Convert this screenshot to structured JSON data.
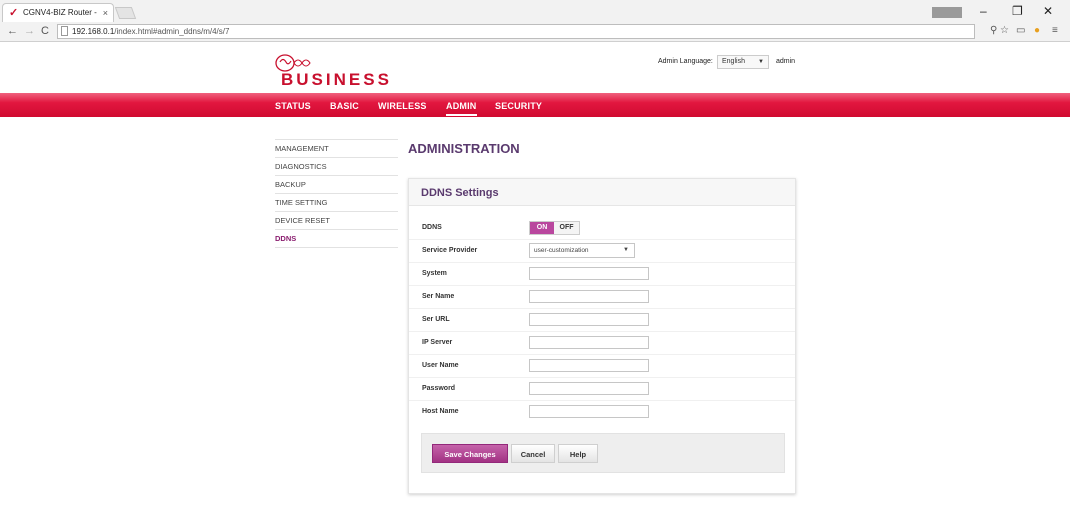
{
  "browser": {
    "tab_title": "CGNV4-BIZ Router -",
    "tab_close": "×",
    "url_host": "192.168.0.1",
    "url_path": "/index.html#admin_ddns/m/4/s/7"
  },
  "header": {
    "brand": "BUSINESS",
    "language_label": "Admin Language:",
    "language_value": "English",
    "user": "admin"
  },
  "nav": {
    "items": [
      {
        "label": "STATUS"
      },
      {
        "label": "BASIC"
      },
      {
        "label": "WIRELESS"
      },
      {
        "label": "ADMIN"
      },
      {
        "label": "SECURITY"
      }
    ],
    "active": "ADMIN"
  },
  "sidebar": {
    "items": [
      {
        "label": "MANAGEMENT"
      },
      {
        "label": "DIAGNOSTICS"
      },
      {
        "label": "BACKUP"
      },
      {
        "label": "TIME SETTING"
      },
      {
        "label": "DEVICE RESET"
      },
      {
        "label": "DDNS"
      }
    ]
  },
  "page": {
    "title": "ADMINISTRATION",
    "card_title": "DDNS Settings"
  },
  "form": {
    "ddns": {
      "label": "DDNS",
      "on": "ON",
      "off": "OFF",
      "state": "ON"
    },
    "service_provider": {
      "label": "Service Provider",
      "value": "user-customization"
    },
    "fields": [
      {
        "label": "System",
        "value": ""
      },
      {
        "label": "Ser Name",
        "value": ""
      },
      {
        "label": "Ser URL",
        "value": ""
      },
      {
        "label": "IP Server",
        "value": ""
      },
      {
        "label": "User Name",
        "value": ""
      },
      {
        "label": "Password",
        "value": ""
      },
      {
        "label": "Host Name",
        "value": ""
      }
    ]
  },
  "actions": {
    "save": "Save Changes",
    "cancel": "Cancel",
    "help": "Help"
  },
  "colors": {
    "brand_red": "#c8102e",
    "accent_purple": "#b9479e",
    "title_purple": "#5a3a6e"
  }
}
